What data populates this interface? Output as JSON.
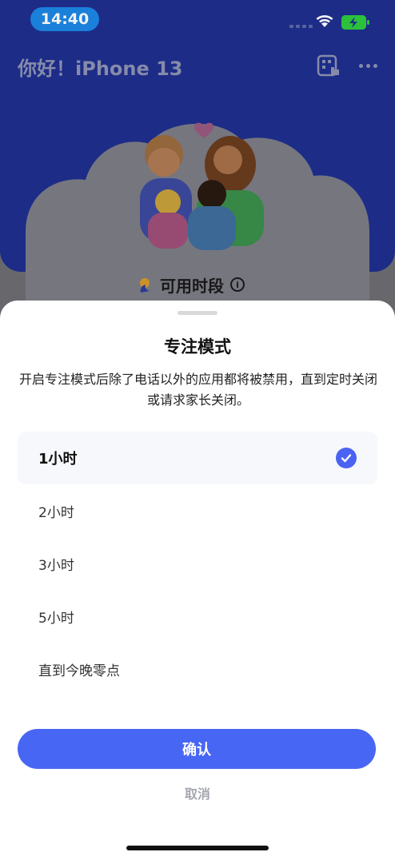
{
  "status_bar": {
    "time": "14:40"
  },
  "header": {
    "title": "你好！iPhone 13"
  },
  "usage": {
    "label": "可用时段",
    "info_glyph": "i"
  },
  "sheet": {
    "title": "专注模式",
    "description": "开启专注模式后除了电话以外的应用都将被禁用，直到定时关闭或请求家长关闭。",
    "options": [
      {
        "label": "1小时",
        "selected": true
      },
      {
        "label": "2小时",
        "selected": false
      },
      {
        "label": "3小时",
        "selected": false
      },
      {
        "label": "5小时",
        "selected": false
      },
      {
        "label": "直到今晚零点",
        "selected": false
      }
    ],
    "confirm_label": "确认",
    "cancel_label": "取消"
  },
  "colors": {
    "accent": "#4866f4",
    "header_bg": "#1f2f8f",
    "time_pill": "#1c87e6",
    "battery": "#2ecc40"
  },
  "icons": [
    "wifi-icon",
    "battery-charging-icon",
    "scan-icon",
    "more-icon",
    "check-icon",
    "info-icon",
    "sun-moon-icon"
  ]
}
